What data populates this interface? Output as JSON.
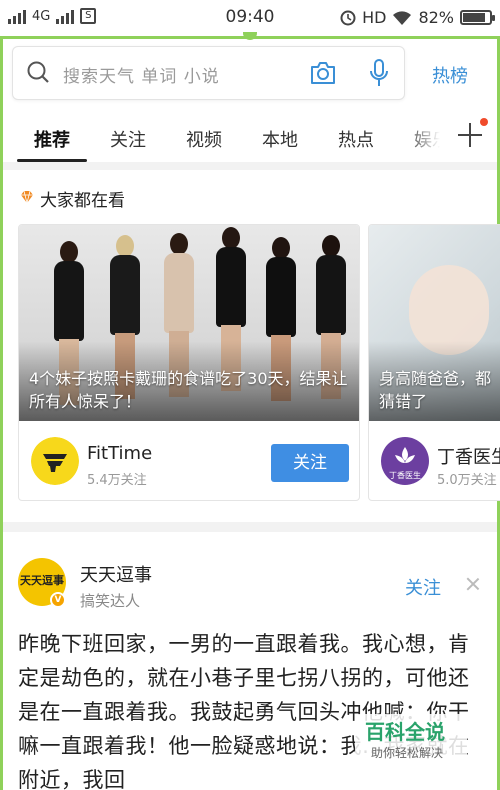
{
  "status_bar": {
    "carrier": "4G",
    "time": "09:40",
    "hd": "HD",
    "battery": "82%",
    "sim_badge": "S"
  },
  "search": {
    "placeholder": "搜索天气 单词 小说",
    "hot_label": "热榜"
  },
  "tabs": [
    {
      "label": "推荐",
      "active": true
    },
    {
      "label": "关注",
      "active": false
    },
    {
      "label": "视频",
      "active": false
    },
    {
      "label": "本地",
      "active": false
    },
    {
      "label": "热点",
      "active": false
    },
    {
      "label": "娱乐",
      "active": false
    }
  ],
  "section": {
    "title": "大家都在看"
  },
  "cards": [
    {
      "caption": "4个妹子按照卡戴珊的食谱吃了30天，结果让所有人惊呆了！",
      "author": "FitTime",
      "fans": "5.4万关注",
      "follow_label": "关注"
    },
    {
      "caption": "身高随爸爸，都猜错了",
      "author": "丁香医生",
      "fans": "5.0万关注",
      "avatar_text": "丁香医生"
    }
  ],
  "article": {
    "author": "天天逗事",
    "avatar_text": "天天逗事",
    "verified": "V",
    "tag": "搞笑达人",
    "follow_label": "关注",
    "body": "昨晚下班回家，一男的一直跟着我。我心想，肯定是劫色的，就在小巷子里七拐八拐的，可他还是在一直跟着我。我鼓起勇气回头冲他喊：你干嘛一直跟着我！他一脸疑惑地说：我…我家就在附近，我回"
  },
  "watermark": {
    "title": "百科全说",
    "subtitle": "助你轻松解决"
  },
  "colors": {
    "accent_blue": "#3f8ee3",
    "link_blue": "#3a8fd6",
    "frame_green": "#8fd15a",
    "badge_red": "#f04b2b"
  }
}
